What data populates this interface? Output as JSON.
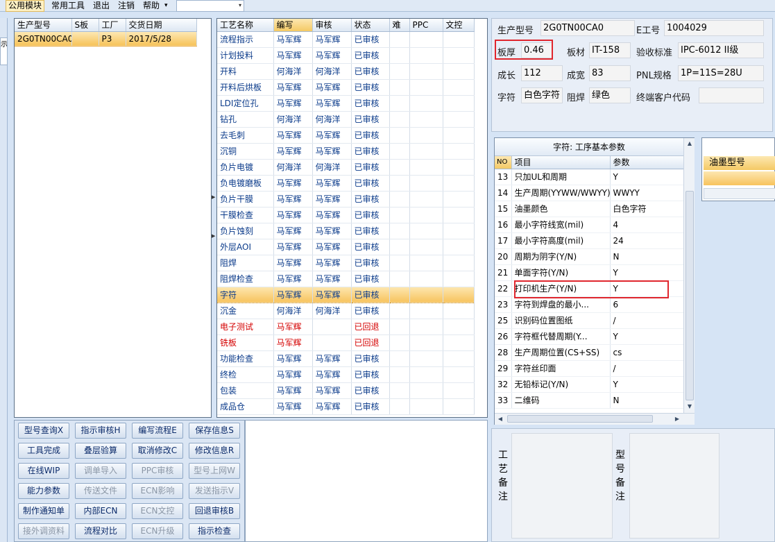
{
  "menu": {
    "items": [
      "公用模块",
      "常用工具",
      "退出",
      "注销",
      "帮助"
    ],
    "help_arrow": "▾",
    "combo_arrow": "▾"
  },
  "left_strip": {
    "label": "示"
  },
  "orders": {
    "columns": [
      "生产型号",
      "S板",
      "工厂",
      "交货日期"
    ],
    "rows": [
      {
        "model": "2G0TN00CA0",
        "s": "",
        "factory": "P3",
        "date": "2017/5/28"
      }
    ]
  },
  "process": {
    "columns": [
      "工艺名称",
      "编写",
      "审核",
      "状态",
      "难",
      "PPC",
      "文控"
    ],
    "selected": "字符",
    "rows": [
      {
        "name": "流程指示",
        "writer": "马军辉",
        "reviewer": "马军辉",
        "status": "已审核",
        "red": false
      },
      {
        "name": "计划投料",
        "writer": "马军辉",
        "reviewer": "马军辉",
        "status": "已审核",
        "red": false
      },
      {
        "name": "开料",
        "writer": "何海洋",
        "reviewer": "何海洋",
        "status": "已审核",
        "red": false
      },
      {
        "name": "开料后烘板",
        "writer": "马军辉",
        "reviewer": "马军辉",
        "status": "已审核",
        "red": false
      },
      {
        "name": "LDI定位孔",
        "writer": "马军辉",
        "reviewer": "马军辉",
        "status": "已审核",
        "red": false
      },
      {
        "name": "钻孔",
        "writer": "何海洋",
        "reviewer": "何海洋",
        "status": "已审核",
        "red": false
      },
      {
        "name": "去毛刺",
        "writer": "马军辉",
        "reviewer": "马军辉",
        "status": "已审核",
        "red": false
      },
      {
        "name": "沉铜",
        "writer": "马军辉",
        "reviewer": "马军辉",
        "status": "已审核",
        "red": false
      },
      {
        "name": "负片电镀",
        "writer": "何海洋",
        "reviewer": "何海洋",
        "status": "已审核",
        "red": false
      },
      {
        "name": "负电镀磨板",
        "writer": "马军辉",
        "reviewer": "马军辉",
        "status": "已审核",
        "red": false
      },
      {
        "name": "负片干膜",
        "writer": "马军辉",
        "reviewer": "马军辉",
        "status": "已审核",
        "red": false
      },
      {
        "name": "干膜检查",
        "writer": "马军辉",
        "reviewer": "马军辉",
        "status": "已审核",
        "red": false
      },
      {
        "name": "负片蚀刻",
        "writer": "马军辉",
        "reviewer": "马军辉",
        "status": "已审核",
        "red": false
      },
      {
        "name": "外层AOI",
        "writer": "马军辉",
        "reviewer": "马军辉",
        "status": "已审核",
        "red": false
      },
      {
        "name": "阻焊",
        "writer": "马军辉",
        "reviewer": "马军辉",
        "status": "已审核",
        "red": false
      },
      {
        "name": "阻焊检查",
        "writer": "马军辉",
        "reviewer": "马军辉",
        "status": "已审核",
        "red": false
      },
      {
        "name": "字符",
        "writer": "马军辉",
        "reviewer": "马军辉",
        "status": "已审核",
        "red": false
      },
      {
        "name": "沉金",
        "writer": "何海洋",
        "reviewer": "何海洋",
        "status": "已审核",
        "red": false
      },
      {
        "name": "电子测试",
        "writer": "马军辉",
        "reviewer": "",
        "status": "已回退",
        "red": true
      },
      {
        "name": "铣板",
        "writer": "马军辉",
        "reviewer": "",
        "status": "已回退",
        "red": true
      },
      {
        "name": "功能检查",
        "writer": "马军辉",
        "reviewer": "马军辉",
        "status": "已审核",
        "red": false
      },
      {
        "name": "终检",
        "writer": "马军辉",
        "reviewer": "马军辉",
        "status": "已审核",
        "red": false
      },
      {
        "name": "包装",
        "writer": "马军辉",
        "reviewer": "马军辉",
        "status": "已审核",
        "red": false
      },
      {
        "name": "成品仓",
        "writer": "马军辉",
        "reviewer": "马军辉",
        "status": "已审核",
        "red": false
      }
    ]
  },
  "buttons": {
    "items": [
      {
        "label": "型号查询X",
        "disabled": false
      },
      {
        "label": "指示审核H",
        "disabled": false
      },
      {
        "label": "编写流程E",
        "disabled": false
      },
      {
        "label": "保存信息S",
        "disabled": false
      },
      {
        "label": "工具完成",
        "disabled": false
      },
      {
        "label": "叠层验算",
        "disabled": false
      },
      {
        "label": "取消修改C",
        "disabled": false
      },
      {
        "label": "修改信息R",
        "disabled": false
      },
      {
        "label": "在线WIP",
        "disabled": false
      },
      {
        "label": "调单导入",
        "disabled": true
      },
      {
        "label": "PPC审核",
        "disabled": true
      },
      {
        "label": "型号上网W",
        "disabled": true
      },
      {
        "label": "能力参数",
        "disabled": false
      },
      {
        "label": "传送文件",
        "disabled": true
      },
      {
        "label": "ECN影响",
        "disabled": true
      },
      {
        "label": "发送指示V",
        "disabled": true
      },
      {
        "label": "制作通知单",
        "disabled": false
      },
      {
        "label": "内部ECN",
        "disabled": false
      },
      {
        "label": "ECN文控",
        "disabled": true
      },
      {
        "label": "回退审核B",
        "disabled": false
      },
      {
        "label": "接外调资料",
        "disabled": true
      },
      {
        "label": "流程对比",
        "disabled": false
      },
      {
        "label": "ECN升级",
        "disabled": true
      },
      {
        "label": "指示检查",
        "disabled": false
      }
    ]
  },
  "info": {
    "model_label": "生产型号",
    "model_value": "2G0TN00CA0",
    "eno_label": "E工号",
    "eno_value": "1004029",
    "thickness_label": "板厚",
    "thickness_value": "0.46",
    "material_label": "板材",
    "material_value": "IT-158",
    "standard_label": "验收标准",
    "standard_value": "IPC-6012 II级",
    "length_label": "成长",
    "length_value": "112",
    "width_label": "成宽",
    "width_value": "83",
    "pnl_label": "PNL规格",
    "pnl_value": "1P=11S=28U",
    "char_label": "字符",
    "char_value": "白色字符",
    "mask_label": "阻焊",
    "mask_value": "绿色",
    "customer_label": "终端客户代码",
    "customer_value": ""
  },
  "params": {
    "title": "字符: 工序基本参数",
    "columns": [
      "NO",
      "项目",
      "参数"
    ],
    "rows": [
      {
        "no": "13",
        "item": "只加UL和周期",
        "value": "Y"
      },
      {
        "no": "14",
        "item": "生产周期(YYWW/WWYY)",
        "value": "WWYY"
      },
      {
        "no": "15",
        "item": "油墨颜色",
        "value": "白色字符"
      },
      {
        "no": "16",
        "item": "最小字符线宽(mil)",
        "value": "4"
      },
      {
        "no": "17",
        "item": "最小字符高度(mil)",
        "value": "24"
      },
      {
        "no": "20",
        "item": "周期为阴字(Y/N)",
        "value": "N"
      },
      {
        "no": "21",
        "item": "单面字符(Y/N)",
        "value": "Y"
      },
      {
        "no": "22",
        "item": "打印机生产(Y/N)",
        "value": "Y"
      },
      {
        "no": "23",
        "item": "字符到焊盘的最小...",
        "value": "6"
      },
      {
        "no": "25",
        "item": "识别码位置图纸",
        "value": "/"
      },
      {
        "no": "26",
        "item": "字符框代替周期(Y...",
        "value": "Y"
      },
      {
        "no": "28",
        "item": "生产周期位置(CS+SS)",
        "value": "cs"
      },
      {
        "no": "29",
        "item": "字符丝印面",
        "value": "/"
      },
      {
        "no": "32",
        "item": "无铅标记(Y/N)",
        "value": "Y"
      },
      {
        "no": "33",
        "item": "二维码",
        "value": "N"
      }
    ]
  },
  "oil": {
    "header": "油墨型号"
  },
  "memo": {
    "process_memo_label": "工艺备注",
    "model_memo_label": "型号备注"
  },
  "colors": {
    "accent": "#f6c259",
    "highlight": "#e0262d",
    "link_text": "#0a3a8a",
    "error_text": "#d40000"
  }
}
